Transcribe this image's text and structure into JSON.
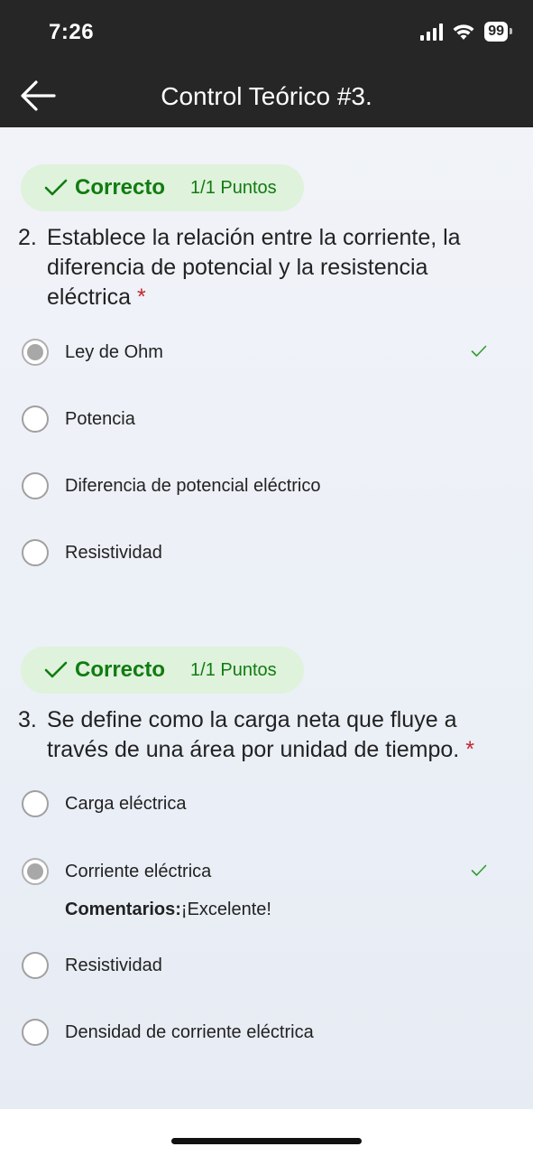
{
  "status_bar": {
    "time": "7:26",
    "battery": "99"
  },
  "header": {
    "title": "Control Teórico #3."
  },
  "questions": [
    {
      "number": "2.",
      "result": "Correcto",
      "points": "1/1 Puntos",
      "text": "Establece la relación entre la corriente, la diferencia de potencial y la resistencia eléctrica",
      "required_mark": "*",
      "options": [
        {
          "label": "Ley de Ohm",
          "selected": true,
          "correct": true
        },
        {
          "label": "Potencia",
          "selected": false,
          "correct": false
        },
        {
          "label": "Diferencia de potencial eléctrico",
          "selected": false,
          "correct": false
        },
        {
          "label": "Resistividad",
          "selected": false,
          "correct": false
        }
      ]
    },
    {
      "number": "3.",
      "result": "Correcto",
      "points": "1/1 Puntos",
      "text": "Se define como la carga neta que fluye a través de una área por unidad de tiempo.",
      "required_mark": "*",
      "options": [
        {
          "label": "Carga eléctrica",
          "selected": false,
          "correct": false
        },
        {
          "label": "Corriente eléctrica",
          "selected": true,
          "correct": true
        },
        {
          "label": "Resistividad",
          "selected": false,
          "correct": false
        },
        {
          "label": "Densidad de corriente eléctrica",
          "selected": false,
          "correct": false
        }
      ],
      "feedback_label": "Comentarios:",
      "feedback_text": "¡Excelente!"
    }
  ],
  "colors": {
    "correct_green": "#107c10",
    "badge_bg": "#dff2dc",
    "required_red": "#c4262e",
    "header_bg": "#262626"
  },
  "icons": [
    "back-arrow-icon",
    "signal-icon",
    "wifi-icon",
    "battery-icon",
    "checkmark-icon",
    "radio-icon"
  ]
}
